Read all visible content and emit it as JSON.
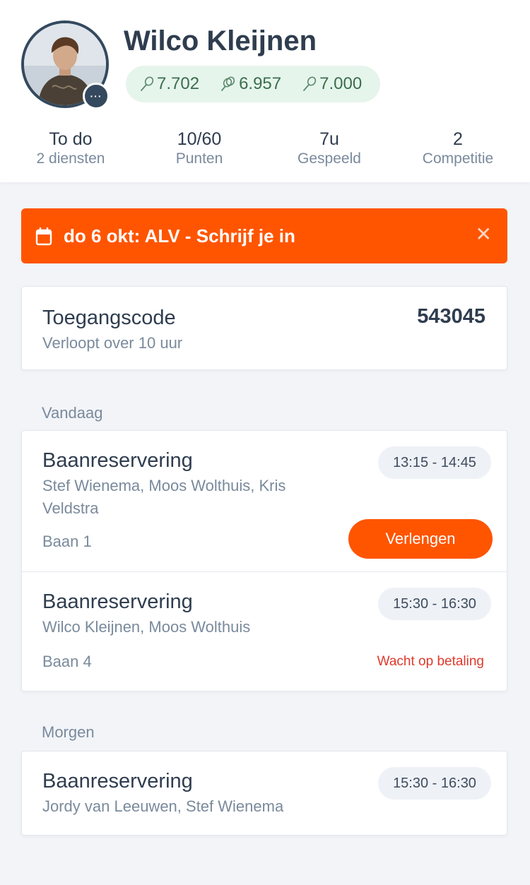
{
  "profile": {
    "name": "Wilco Kleijnen",
    "more_label": "···",
    "ratings": [
      {
        "icon": "racket-icon",
        "value": "7.702"
      },
      {
        "icon": "racket-double-icon",
        "value": "6.957"
      },
      {
        "icon": "racket-icon",
        "value": "7.000"
      }
    ]
  },
  "stats": [
    {
      "value": "To do",
      "label": "2 diensten"
    },
    {
      "value": "10/60",
      "label": "Punten"
    },
    {
      "value": "7u",
      "label": "Gespeeld"
    },
    {
      "value": "2",
      "label": "Competitie"
    }
  ],
  "banner": {
    "icon": "calendar-icon",
    "text": "do 6 okt: ALV - Schrijf je in",
    "close_icon": "close-icon",
    "close_glyph": "✕",
    "color": "#ff5500"
  },
  "access_code": {
    "title": "Toegangscode",
    "subtitle": "Verloopt over 10 uur",
    "code": "543045"
  },
  "sections": {
    "today_label": "Vandaag",
    "tomorrow_label": "Morgen"
  },
  "reservations_today": [
    {
      "title": "Baanreservering",
      "players": "Stef Wienema, Moos Wolthuis, Kris Veldstra",
      "court": "Baan 1",
      "time": "13:15 - 14:45",
      "action": "Verlengen"
    },
    {
      "title": "Baanreservering",
      "players": "Wilco Kleijnen, Moos Wolthuis",
      "court": "Baan 4",
      "time": "15:30 - 16:30",
      "status": "Wacht op betaling"
    }
  ],
  "reservations_tomorrow": [
    {
      "title": "Baanreservering",
      "players": "Jordy van Leeuwen, Stef Wienema",
      "time": "15:30 - 16:30"
    }
  ]
}
